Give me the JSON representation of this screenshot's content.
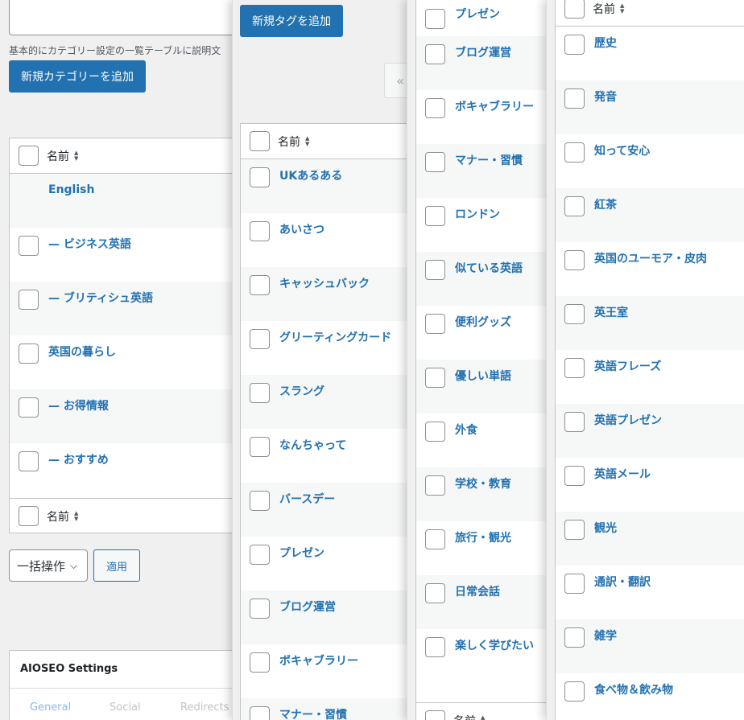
{
  "panel1": {
    "hint": "基本的にカテゴリー設定の一覧テーブルに説明文",
    "add_button": "新規カテゴリーを追加",
    "column_name": "名前",
    "rows": [
      {
        "label": "English",
        "checkbox": false
      },
      {
        "label": "— ビジネス英語",
        "checkbox": true
      },
      {
        "label": "— ブリティシュ英語",
        "checkbox": true
      },
      {
        "label": "英国の暮らし",
        "checkbox": true
      },
      {
        "label": "— お得情報",
        "checkbox": true
      },
      {
        "label": "— おすすめ",
        "checkbox": true
      }
    ],
    "bulk_action": "一括操作",
    "apply": "適用",
    "aioseo_title": "AIOSEO Settings",
    "aioseo_tabs": [
      "General",
      "Social",
      "Redirects"
    ]
  },
  "panel2": {
    "add_button": "新規タグを追加",
    "pager_prev": "«",
    "column_name": "名前",
    "rows": [
      "UKあるある",
      "あいさつ",
      "キャッシュバック",
      "グリーティングカード",
      "スラング",
      "なんちゃって",
      "バースデー",
      "プレゼン",
      "ブログ運営",
      "ボキャブラリー",
      "マナー・習慣"
    ]
  },
  "panel3": {
    "column_name": "名前",
    "rows": [
      "プレゼン",
      "ブログ運営",
      "ボキャブラリー",
      "マナー・習慣",
      "ロンドン",
      "似ている英語",
      "便利グッズ",
      "優しい単語",
      "外食",
      "学校・教育",
      "旅行・観光",
      "日常会話",
      "楽しく学びたい"
    ]
  },
  "panel4": {
    "column_name": "名前",
    "rows": [
      "歴史",
      "発音",
      "知って安心",
      "紅茶",
      "英国のユーモア・皮肉",
      "英王室",
      "英語フレーズ",
      "英語プレゼン",
      "英語メール",
      "観光",
      "通訳・翻訳",
      "雑学",
      "食べ物＆飲み物"
    ]
  },
  "colors": {
    "accent": "#2271b1",
    "border": "#c3c4c7",
    "stripe": "#f6f7f7"
  }
}
